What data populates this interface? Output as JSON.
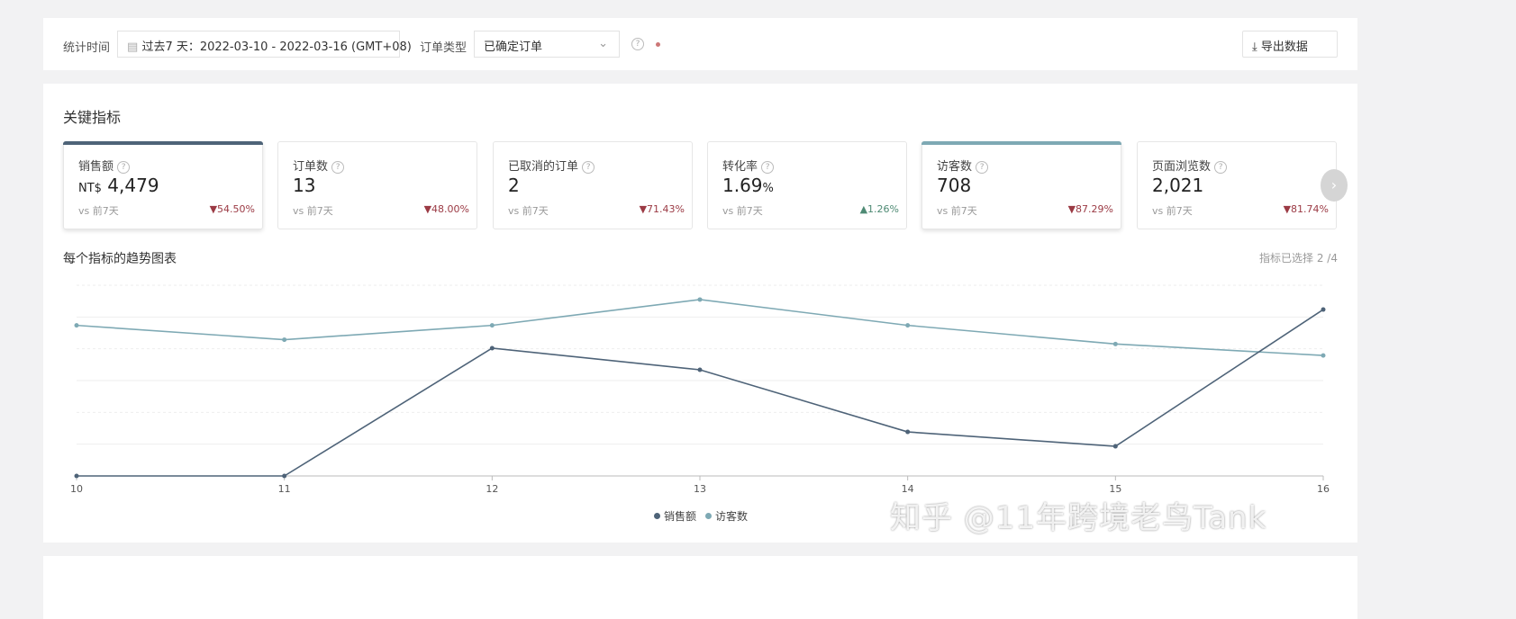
{
  "filters": {
    "time_label": "统计时间",
    "time_value": "过去7 天：2022-03-10 - 2022-03-16 (GMT+08)",
    "order_type_label": "订单类型",
    "order_type_value": "已确定订单",
    "export_label": "导出数据"
  },
  "section_title": "关键指标",
  "kpis": [
    {
      "name": "销售额",
      "prefix": "NT$",
      "value": "4,479",
      "suffix": "",
      "vs": "vs 前7天",
      "change": "54.50%",
      "dir": "down",
      "selected": true,
      "color": "#4e6378"
    },
    {
      "name": "订单数",
      "prefix": "",
      "value": "13",
      "suffix": "",
      "vs": "vs 前7天",
      "change": "48.00%",
      "dir": "down",
      "selected": false
    },
    {
      "name": "已取消的订单",
      "prefix": "",
      "value": "2",
      "suffix": "",
      "vs": "vs 前7天",
      "change": "71.43%",
      "dir": "down",
      "selected": false
    },
    {
      "name": "转化率",
      "prefix": "",
      "value": "1.69",
      "suffix": "%",
      "vs": "vs 前7天",
      "change": "1.26%",
      "dir": "up",
      "selected": false
    },
    {
      "name": "访客数",
      "prefix": "",
      "value": "708",
      "suffix": "",
      "vs": "vs 前7天",
      "change": "87.29%",
      "dir": "down",
      "selected": true,
      "color": "#7ea9b4"
    },
    {
      "name": "页面浏览数",
      "prefix": "",
      "value": "2,021",
      "suffix": "",
      "vs": "vs 前7天",
      "change": "81.74%",
      "dir": "down",
      "selected": false
    }
  ],
  "trend_title": "每个指标的趋势图表",
  "selected_count": "指标已选择 2 /4",
  "chart_data": {
    "type": "line",
    "categories": [
      "10",
      "11",
      "12",
      "13",
      "14",
      "15",
      "16"
    ],
    "series": [
      {
        "name": "销售额",
        "color": "#4e6378",
        "values": [
          0,
          0,
          1207,
          1003,
          416,
          280,
          1572
        ],
        "ylim": [
          0,
          1802
        ]
      },
      {
        "name": "访客数",
        "color": "#7ea9b4",
        "values": [
          105,
          95,
          105,
          123,
          105,
          92,
          84
        ],
        "ylim": [
          0,
          133
        ]
      }
    ],
    "grid": true,
    "legend": "bottom"
  },
  "watermark": "知乎 @11年跨境老鸟Tank"
}
